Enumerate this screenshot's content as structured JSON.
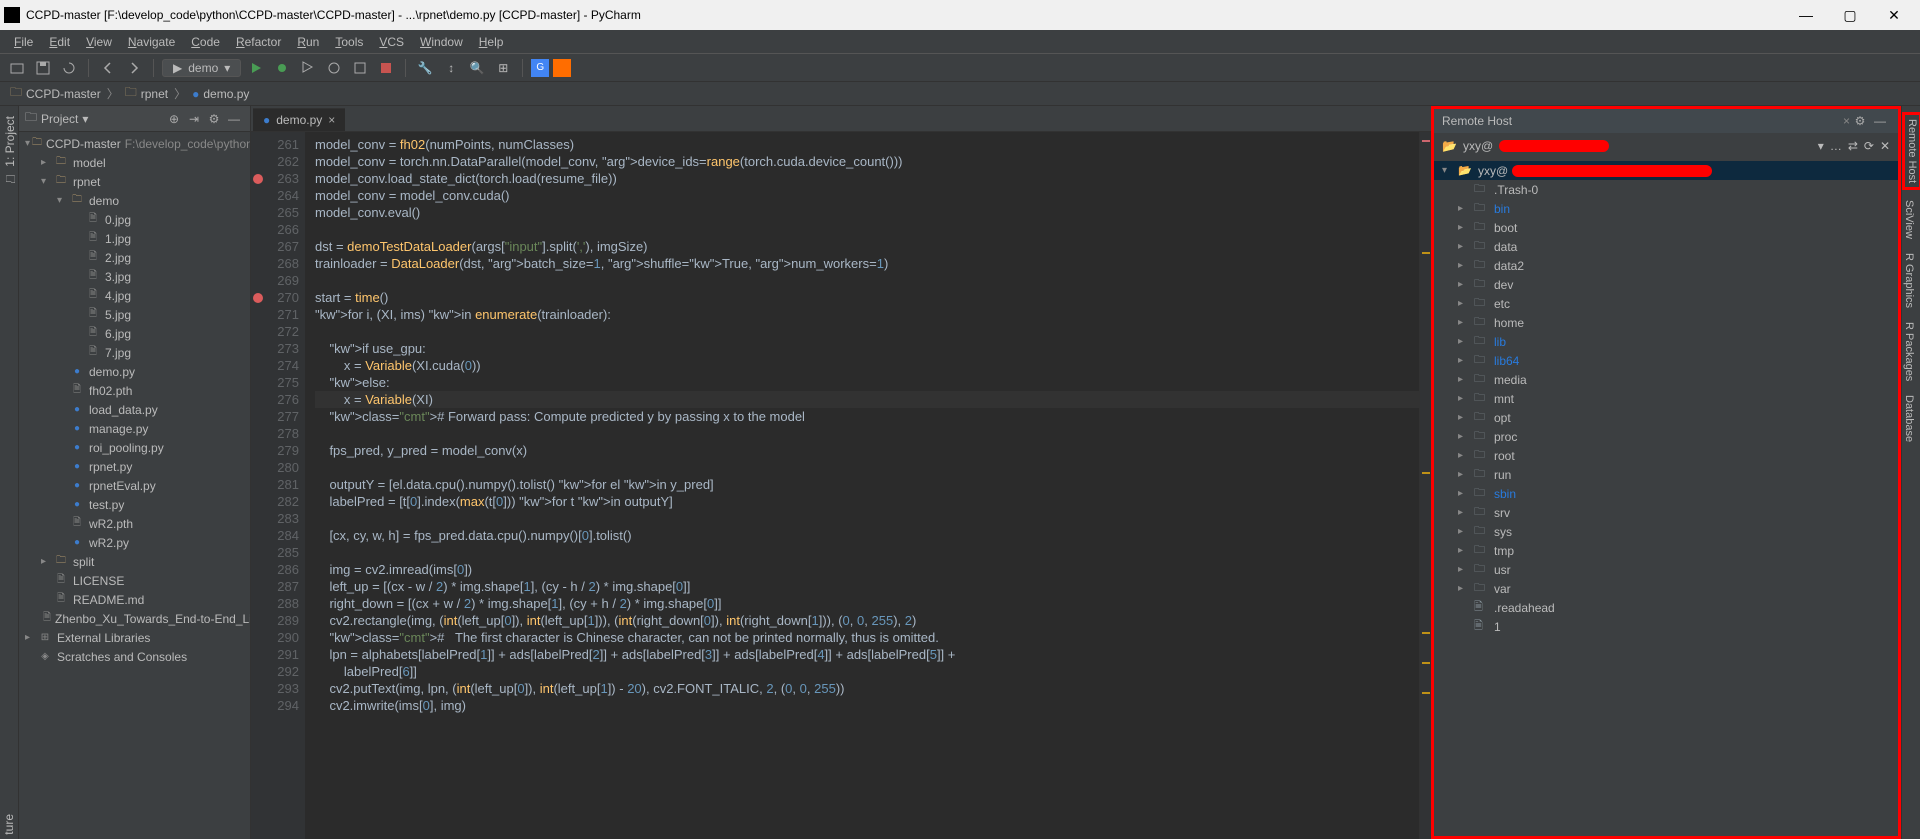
{
  "window": {
    "title": "CCPD-master [F:\\develop_code\\python\\CCPD-master\\CCPD-master] - ...\\rpnet\\demo.py [CCPD-master] - PyCharm"
  },
  "menu": [
    "File",
    "Edit",
    "View",
    "Navigate",
    "Code",
    "Refactor",
    "Run",
    "Tools",
    "VCS",
    "Window",
    "Help"
  ],
  "run_config": "demo",
  "breadcrumb": [
    {
      "icon": "folder",
      "label": "CCPD-master"
    },
    {
      "icon": "folder",
      "label": "rpnet"
    },
    {
      "icon": "pyfile",
      "label": "demo.py"
    }
  ],
  "project_panel_title": "Project",
  "project_tree": [
    {
      "depth": 0,
      "arrow": "▾",
      "icon": "folder",
      "label": "CCPD-master",
      "path": "F:\\develop_code\\python\\CCPD"
    },
    {
      "depth": 1,
      "arrow": "▸",
      "icon": "folder",
      "label": "model"
    },
    {
      "depth": 1,
      "arrow": "▾",
      "icon": "folder",
      "label": "rpnet"
    },
    {
      "depth": 2,
      "arrow": "▾",
      "icon": "folder",
      "label": "demo"
    },
    {
      "depth": 3,
      "arrow": "",
      "icon": "file",
      "label": "0.jpg"
    },
    {
      "depth": 3,
      "arrow": "",
      "icon": "file",
      "label": "1.jpg"
    },
    {
      "depth": 3,
      "arrow": "",
      "icon": "file",
      "label": "2.jpg"
    },
    {
      "depth": 3,
      "arrow": "",
      "icon": "file",
      "label": "3.jpg"
    },
    {
      "depth": 3,
      "arrow": "",
      "icon": "file",
      "label": "4.jpg"
    },
    {
      "depth": 3,
      "arrow": "",
      "icon": "file",
      "label": "5.jpg"
    },
    {
      "depth": 3,
      "arrow": "",
      "icon": "file",
      "label": "6.jpg"
    },
    {
      "depth": 3,
      "arrow": "",
      "icon": "file",
      "label": "7.jpg"
    },
    {
      "depth": 2,
      "arrow": "",
      "icon": "pyfile",
      "label": "demo.py"
    },
    {
      "depth": 2,
      "arrow": "",
      "icon": "file",
      "label": "fh02.pth"
    },
    {
      "depth": 2,
      "arrow": "",
      "icon": "pyfile",
      "label": "load_data.py"
    },
    {
      "depth": 2,
      "arrow": "",
      "icon": "pyfile",
      "label": "manage.py"
    },
    {
      "depth": 2,
      "arrow": "",
      "icon": "pyfile",
      "label": "roi_pooling.py"
    },
    {
      "depth": 2,
      "arrow": "",
      "icon": "pyfile",
      "label": "rpnet.py"
    },
    {
      "depth": 2,
      "arrow": "",
      "icon": "pyfile",
      "label": "rpnetEval.py"
    },
    {
      "depth": 2,
      "arrow": "",
      "icon": "pyfile",
      "label": "test.py"
    },
    {
      "depth": 2,
      "arrow": "",
      "icon": "file",
      "label": "wR2.pth"
    },
    {
      "depth": 2,
      "arrow": "",
      "icon": "pyfile",
      "label": "wR2.py"
    },
    {
      "depth": 1,
      "arrow": "▸",
      "icon": "folder",
      "label": "split"
    },
    {
      "depth": 1,
      "arrow": "",
      "icon": "file",
      "label": "LICENSE"
    },
    {
      "depth": 1,
      "arrow": "",
      "icon": "file",
      "label": "README.md"
    },
    {
      "depth": 1,
      "arrow": "",
      "icon": "file",
      "label": "Zhenbo_Xu_Towards_End-to-End_Licen"
    },
    {
      "depth": 0,
      "arrow": "▸",
      "icon": "lib",
      "label": "External Libraries"
    },
    {
      "depth": 0,
      "arrow": "",
      "icon": "scratch",
      "label": "Scratches and Consoles"
    }
  ],
  "editor_tab": "demo.py",
  "code_start_line": 261,
  "breakpoints": [
    263,
    270
  ],
  "code_lines": [
    "model_conv = fh02(numPoints, numClasses)",
    "model_conv = torch.nn.DataParallel(model_conv, device_ids=range(torch.cuda.device_count()))",
    "model_conv.load_state_dict(torch.load(resume_file))",
    "model_conv = model_conv.cuda()",
    "model_conv.eval()",
    "",
    "dst = demoTestDataLoader(args[\"input\"].split(','), imgSize)",
    "trainloader = DataLoader(dst, batch_size=1, shuffle=True, num_workers=1)",
    "",
    "start = time()",
    "for i, (XI, ims) in enumerate(trainloader):",
    "",
    "    if use_gpu:",
    "        x = Variable(XI.cuda(0))",
    "    else:",
    "        x = Variable(XI)",
    "    # Forward pass: Compute predicted y by passing x to the model",
    "",
    "    fps_pred, y_pred = model_conv(x)",
    "",
    "    outputY = [el.data.cpu().numpy().tolist() for el in y_pred]",
    "    labelPred = [t[0].index(max(t[0])) for t in outputY]",
    "",
    "    [cx, cy, w, h] = fps_pred.data.cpu().numpy()[0].tolist()",
    "",
    "    img = cv2.imread(ims[0])",
    "    left_up = [(cx - w / 2) * img.shape[1], (cy - h / 2) * img.shape[0]]",
    "    right_down = [(cx + w / 2) * img.shape[1], (cy + h / 2) * img.shape[0]]",
    "    cv2.rectangle(img, (int(left_up[0]), int(left_up[1])), (int(right_down[0]), int(right_down[1])), (0, 0, 255), 2)",
    "    #   The first character is Chinese character, can not be printed normally, thus is omitted.",
    "    lpn = alphabets[labelPred[1]] + ads[labelPred[2]] + ads[labelPred[3]] + ads[labelPred[4]] + ads[labelPred[5]] + ",
    "        labelPred[6]]",
    "    cv2.putText(img, lpn, (int(left_up[0]), int(left_up[1]) - 20), cv2.FONT_ITALIC, 2, (0, 0, 255))",
    "    cv2.imwrite(ims[0], img)"
  ],
  "remote_panel_title": "Remote Host",
  "remote_host_prefix": "yxy@",
  "remote_tree": [
    {
      "arrow": "",
      "icon": "folder",
      "label": ".Trash-0"
    },
    {
      "arrow": "▸",
      "icon": "folder",
      "label": "bin",
      "link": true
    },
    {
      "arrow": "▸",
      "icon": "folder",
      "label": "boot"
    },
    {
      "arrow": "▸",
      "icon": "folder",
      "label": "data"
    },
    {
      "arrow": "▸",
      "icon": "folder",
      "label": "data2"
    },
    {
      "arrow": "▸",
      "icon": "folder",
      "label": "dev"
    },
    {
      "arrow": "▸",
      "icon": "folder",
      "label": "etc"
    },
    {
      "arrow": "▸",
      "icon": "folder",
      "label": "home"
    },
    {
      "arrow": "▸",
      "icon": "folder",
      "label": "lib",
      "link": true
    },
    {
      "arrow": "▸",
      "icon": "folder",
      "label": "lib64",
      "link": true
    },
    {
      "arrow": "▸",
      "icon": "folder",
      "label": "media"
    },
    {
      "arrow": "▸",
      "icon": "folder",
      "label": "mnt"
    },
    {
      "arrow": "▸",
      "icon": "folder",
      "label": "opt"
    },
    {
      "arrow": "▸",
      "icon": "folder",
      "label": "proc"
    },
    {
      "arrow": "▸",
      "icon": "folder",
      "label": "root"
    },
    {
      "arrow": "▸",
      "icon": "folder",
      "label": "run"
    },
    {
      "arrow": "▸",
      "icon": "folder",
      "label": "sbin",
      "link": true
    },
    {
      "arrow": "▸",
      "icon": "folder",
      "label": "srv"
    },
    {
      "arrow": "▸",
      "icon": "folder",
      "label": "sys"
    },
    {
      "arrow": "▸",
      "icon": "folder",
      "label": "tmp"
    },
    {
      "arrow": "▸",
      "icon": "folder",
      "label": "usr"
    },
    {
      "arrow": "▸",
      "icon": "folder",
      "label": "var"
    },
    {
      "arrow": "",
      "icon": "file",
      "label": ".readahead"
    },
    {
      "arrow": "",
      "icon": "file",
      "label": "1"
    }
  ],
  "right_tools": [
    "Remote Host",
    "SciView",
    "R Graphics",
    "R Packages",
    "Database"
  ],
  "left_bottom_tool": "ture"
}
